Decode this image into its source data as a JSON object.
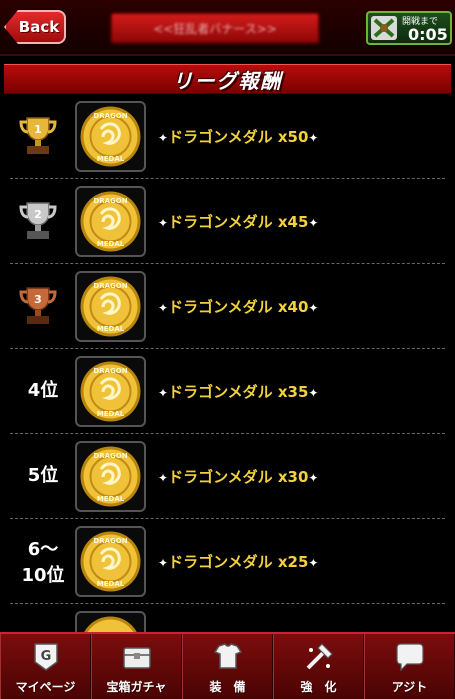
{
  "header": {
    "back_label": "Back",
    "title": "<<狂乱者バナース>>",
    "timer_label": "開戦まで",
    "timer_value": "0:05"
  },
  "section": {
    "title": "リーグ報酬"
  },
  "rewards": [
    {
      "rank_label": "1",
      "rank_type": "gold-trophy",
      "reward": "ドラゴンメダル x50"
    },
    {
      "rank_label": "2",
      "rank_type": "silver-trophy",
      "reward": "ドラゴンメダル x45"
    },
    {
      "rank_label": "3",
      "rank_type": "bronze-trophy",
      "reward": "ドラゴンメダル x40"
    },
    {
      "rank_label": "4位",
      "rank_type": "text",
      "reward": "ドラゴンメダル x35"
    },
    {
      "rank_label": "5位",
      "rank_type": "text",
      "reward": "ドラゴンメダル x30"
    },
    {
      "rank_label": "6〜",
      "rank_label_2": "10位",
      "rank_type": "text",
      "reward": "ドラゴンメダル x25"
    }
  ],
  "medal": {
    "line1": "DRAGON",
    "line2": "MEDAL"
  },
  "nav": [
    {
      "label": "マイページ",
      "icon": "mypage-icon"
    },
    {
      "label": "宝箱ガチャ",
      "icon": "treasure-chest-icon"
    },
    {
      "label": "装　備",
      "icon": "armor-icon"
    },
    {
      "label": "強　化",
      "icon": "enhance-icon"
    },
    {
      "label": "アジト",
      "icon": "hideout-icon"
    }
  ],
  "colors": {
    "accent": "#b80c0c",
    "reward_text": "#f2d23c",
    "timer_border": "#6fb33f"
  }
}
